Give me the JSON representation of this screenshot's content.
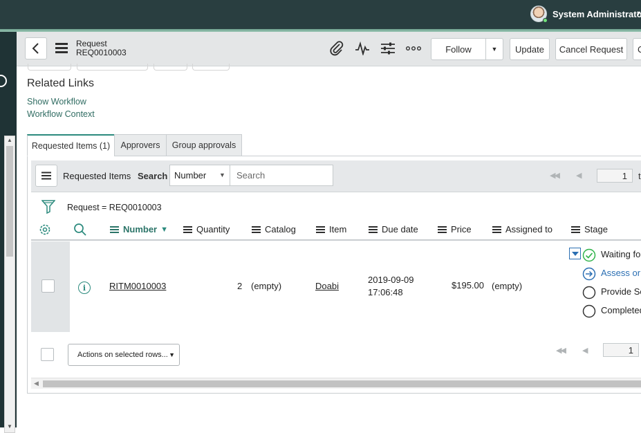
{
  "banner": {
    "user_name": "System Administrator"
  },
  "form_header": {
    "record_type": "Request",
    "record_number": "REQ0010003",
    "icons": [
      "back-arrow-icon",
      "hamburger-menu-icon",
      "paperclip-icon",
      "activity-pulse-icon",
      "settings-sliders-icon",
      "more-options-icon"
    ],
    "buttons": {
      "follow": "Follow",
      "update": "Update",
      "cancel_request": "Cancel Request",
      "extra": "C"
    }
  },
  "related_links": {
    "title": "Related Links",
    "links": [
      "Show Workflow",
      "Workflow Context"
    ]
  },
  "tabs": [
    {
      "label": "Requested Items (1)",
      "active": true
    },
    {
      "label": "Approvers",
      "active": false
    },
    {
      "label": "Group approvals",
      "active": false
    }
  ],
  "list": {
    "title": "Requested Items",
    "search_label": "Search",
    "search_field": "Number",
    "search_placeholder": "Search",
    "page": "1",
    "page_to": "t",
    "breadcrumb": "Request = REQ0010003",
    "columns": [
      "Number",
      "Quantity",
      "Catalog",
      "Item",
      "Due date",
      "Price",
      "Assigned to",
      "Stage"
    ],
    "sort_column": "Number",
    "rows": [
      {
        "number": "RITM0010003",
        "quantity": "2",
        "catalog": "(empty)",
        "item": "Doabi",
        "due_date_day": "2019-09-09",
        "due_date_time": "17:06:48",
        "price": "$195.00",
        "assigned_to": "(empty)",
        "stages": [
          {
            "label": "Waiting for",
            "state": "complete"
          },
          {
            "label": "Assess or S",
            "state": "current"
          },
          {
            "label": "Provide Se",
            "state": "pending"
          },
          {
            "label": "Completed",
            "state": "pending"
          }
        ]
      }
    ],
    "actions_label": "Actions on selected rows...",
    "footer_page": "1"
  },
  "colors": {
    "banner": "#293e40",
    "accent": "#2b8a7d",
    "link": "#316d63",
    "stage_current": "#2b6fb3",
    "stage_complete": "#2fb34a"
  }
}
